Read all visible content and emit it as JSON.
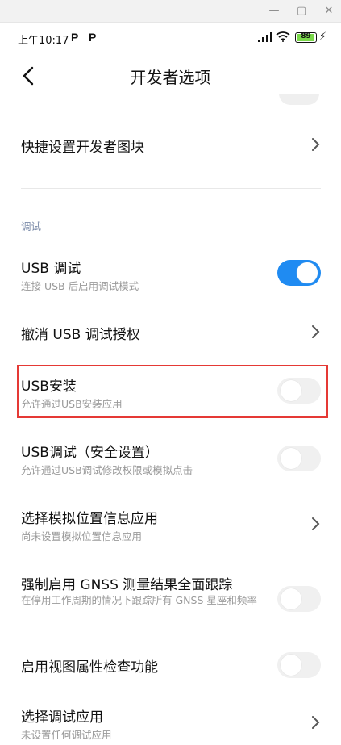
{
  "window_controls": {
    "minimize": "—",
    "maximize": "▢",
    "close": "✕"
  },
  "status_bar": {
    "time": "上午10:17",
    "notif_icons": [
      "P",
      "P"
    ],
    "battery": "89",
    "charging": "⚡"
  },
  "header": {
    "title": "开发者选项"
  },
  "settings": {
    "quick_tiles": {
      "label": "快捷设置开发者图块"
    },
    "section_debug": "调试",
    "usb_debug": {
      "label": "USB 调试",
      "subtitle": "连接 USB 后启用调试模式",
      "enabled": true
    },
    "revoke_usb": {
      "label": "撤消 USB 调试授权"
    },
    "usb_install": {
      "label": "USB安装",
      "subtitle": "允许通过USB安装应用",
      "enabled": false
    },
    "usb_debug_security": {
      "label": "USB调试（安全设置）",
      "subtitle": "允许通过USB调试修改权限或模拟点击",
      "enabled": false
    },
    "mock_location": {
      "label": "选择模拟位置信息应用",
      "subtitle": "尚未设置模拟位置信息应用"
    },
    "gnss": {
      "label": "强制启用 GNSS 测量结果全面跟踪",
      "subtitle": "在停用工作周期的情况下跟踪所有 GNSS 星座和频率",
      "enabled": false
    },
    "view_attr": {
      "label": "启用视图属性检查功能",
      "enabled": false
    },
    "debug_app": {
      "label": "选择调试应用",
      "subtitle": "未设置任何调试应用"
    }
  },
  "colors": {
    "toggle_on": "#1f8bf2",
    "highlight": "#e53935"
  }
}
